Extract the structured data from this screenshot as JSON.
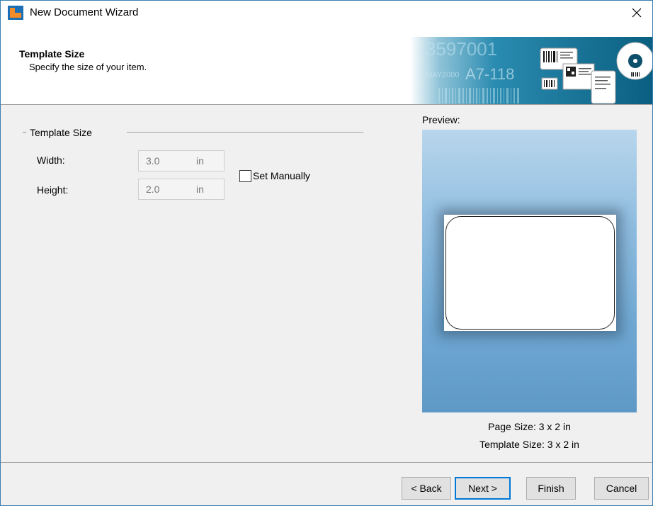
{
  "window": {
    "title": "New Document Wizard",
    "close_glyph": "✕"
  },
  "header": {
    "title": "Template Size",
    "subtitle": "Specify the size of your item.",
    "banner": {
      "big_number": "3597001",
      "code": "A7-118",
      "date_fragment": "MAY2000"
    }
  },
  "template_group": {
    "label": "Template Size",
    "width_label": "Width:",
    "width_value": "3.0",
    "width_unit": "in",
    "height_label": "Height:",
    "height_value": "2.0",
    "height_unit": "in",
    "set_manually_label": "Set Manually",
    "set_manually_checked": false
  },
  "preview": {
    "label": "Preview:",
    "page_size": "Page Size:  3 x 2 in",
    "template_size": "Template Size:  3 x 2 in"
  },
  "buttons": {
    "back": "< Back",
    "next": "Next >",
    "finish": "Finish",
    "cancel": "Cancel"
  },
  "colors": {
    "accent": "#0078d7",
    "logo_orange": "#f28c28",
    "logo_blue": "#1c6fb5",
    "banner_dark": "#0b6c8f"
  },
  "icons": {
    "app_logo": "app-logo-icon",
    "close": "close-icon",
    "banner": "labels-banner-image"
  }
}
